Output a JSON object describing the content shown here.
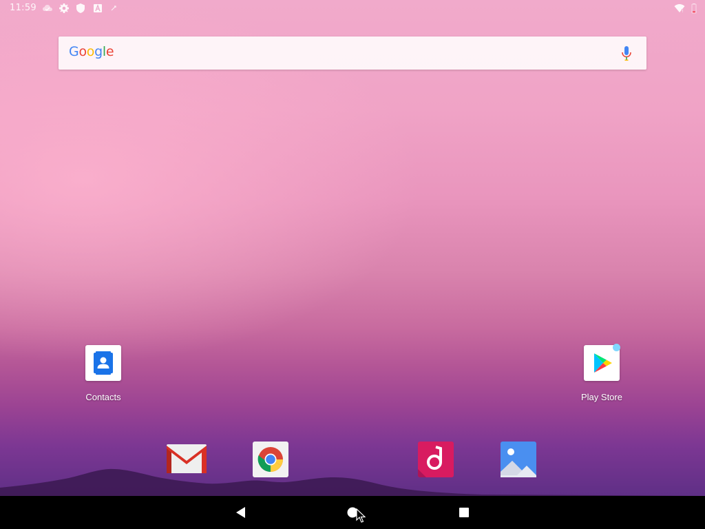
{
  "status_bar": {
    "time": "11:59",
    "left_icons": [
      "cloud-notification-icon",
      "gear-icon",
      "shield-icon",
      "a-letter-icon",
      "sync-icon"
    ],
    "right_icons": [
      "wifi-icon",
      "battery-icon"
    ]
  },
  "search": {
    "logo_letters": [
      {
        "char": "G",
        "color": "#4285F4"
      },
      {
        "char": "o",
        "color": "#EA4335"
      },
      {
        "char": "o",
        "color": "#FBBC05"
      },
      {
        "char": "g",
        "color": "#4285F4"
      },
      {
        "char": "l",
        "color": "#34A853"
      },
      {
        "char": "e",
        "color": "#EA4335"
      }
    ],
    "mic_icon": "mic-icon"
  },
  "desktop_apps": [
    {
      "label": "Contacts",
      "icon": "contacts-icon"
    },
    {
      "label": "Play Store",
      "icon": "play-store-icon"
    }
  ],
  "dock_apps": [
    {
      "icon": "gmail-icon"
    },
    {
      "icon": "chrome-icon"
    },
    {
      "icon": "music-icon"
    },
    {
      "icon": "gallery-icon"
    }
  ],
  "nav_bar": {
    "buttons": [
      "back-icon",
      "home-icon",
      "recents-icon"
    ]
  },
  "colors": {
    "wallpaper_top": "#f1aacb",
    "wallpaper_bottom": "#5f2f86",
    "nav_bar": "#000000"
  }
}
